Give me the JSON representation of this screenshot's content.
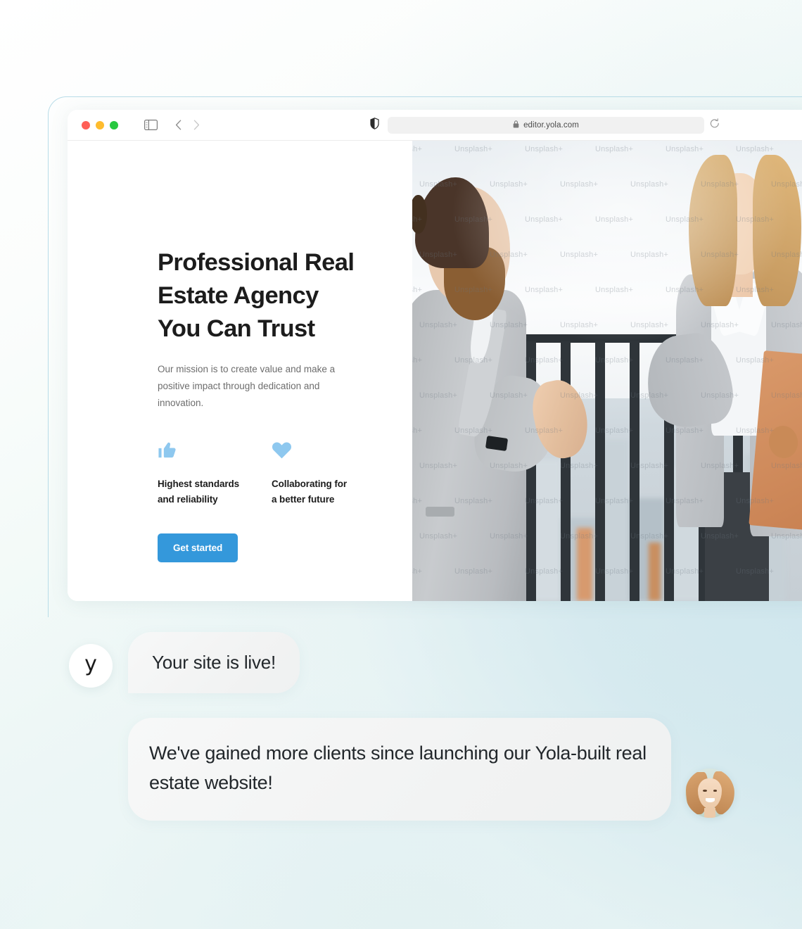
{
  "browser": {
    "traffic_lights": [
      "close",
      "minimize",
      "maximize"
    ],
    "sidebar_toggle_icon": "sidebar-toggle-icon",
    "back_icon": "chevron-left-icon",
    "forward_icon": "chevron-right-icon",
    "shield_icon": "shield-icon",
    "lock_icon": "lock-icon",
    "url": "editor.yola.com",
    "reload_icon": "reload-icon"
  },
  "site": {
    "hero": {
      "title_lines": [
        "Professional Real",
        "Estate Agency",
        "You Can Trust"
      ],
      "subtitle": "Our mission is to create value and make a positive impact through dedication and innovation.",
      "features": [
        {
          "icon": "thumbs-up-icon",
          "label_lines": [
            "Highest standards",
            "and reliability"
          ]
        },
        {
          "icon": "heart-icon",
          "label_lines": [
            "Collaborating for",
            "a better future"
          ]
        }
      ],
      "cta_label": "Get started",
      "photo_alt": "Two business people shaking hands on a rooftop with a city skyline",
      "watermark_text": "Unsplash+"
    }
  },
  "chat": {
    "yola_logo_letter": "y",
    "messages": [
      {
        "from": "yola",
        "text": "Your site is live!"
      },
      {
        "from": "user",
        "text": "We've gained more clients since launching our Yola-built real estate website!"
      }
    ],
    "user_avatar_alt": "Smiling woman profile photo"
  },
  "colors": {
    "accent": "#3498db",
    "feature_icon": "#8ec8ef",
    "page_gradient_start": "#ffffff",
    "page_gradient_end": "#d8ebee",
    "frame_border": "#b8dce8",
    "bubble_bg": "#f3f4f4",
    "text_dark": "#1c1c1c",
    "text_muted": "#6d6d6d"
  }
}
